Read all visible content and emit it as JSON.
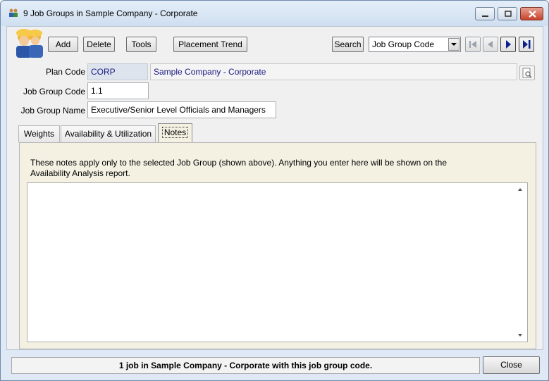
{
  "window": {
    "title": "9 Job Groups in Sample Company - Corporate",
    "icon": "people-icon"
  },
  "toolbar": {
    "add_label": "Add",
    "delete_label": "Delete",
    "tools_label": "Tools",
    "placement_trend_label": "Placement Trend",
    "search_label": "Search",
    "search_field_value": "Job Group Code",
    "nav": [
      "first-record-icon",
      "previous-record-icon",
      "next-record-icon",
      "last-record-icon"
    ]
  },
  "form": {
    "plan_code_label": "Plan Code",
    "plan_code_value": "CORP",
    "plan_description": "Sample Company - Corporate",
    "job_group_code_label": "Job Group Code",
    "job_group_code_value": "1.1",
    "job_group_name_label": "Job Group Name",
    "job_group_name_value": "Executive/Senior Level Officials and Managers"
  },
  "tabs": [
    {
      "label": "Weights"
    },
    {
      "label": "Availability & Utilization"
    },
    {
      "label": "Notes"
    }
  ],
  "notes": {
    "instructions_line1": "These notes apply only to the selected Job Group (shown above).  Anything you enter here will be shown on the",
    "instructions_line2": "Availability Analysis report.",
    "value": ""
  },
  "status": {
    "text": "1 job in Sample Company - Corporate with this job group code."
  },
  "footer": {
    "close_label": "Close"
  },
  "colors": {
    "title_bg": "#dfe9f5",
    "tab_pane_bg": "#f4f1e3",
    "nav_arrow": "#0b1f8c"
  }
}
